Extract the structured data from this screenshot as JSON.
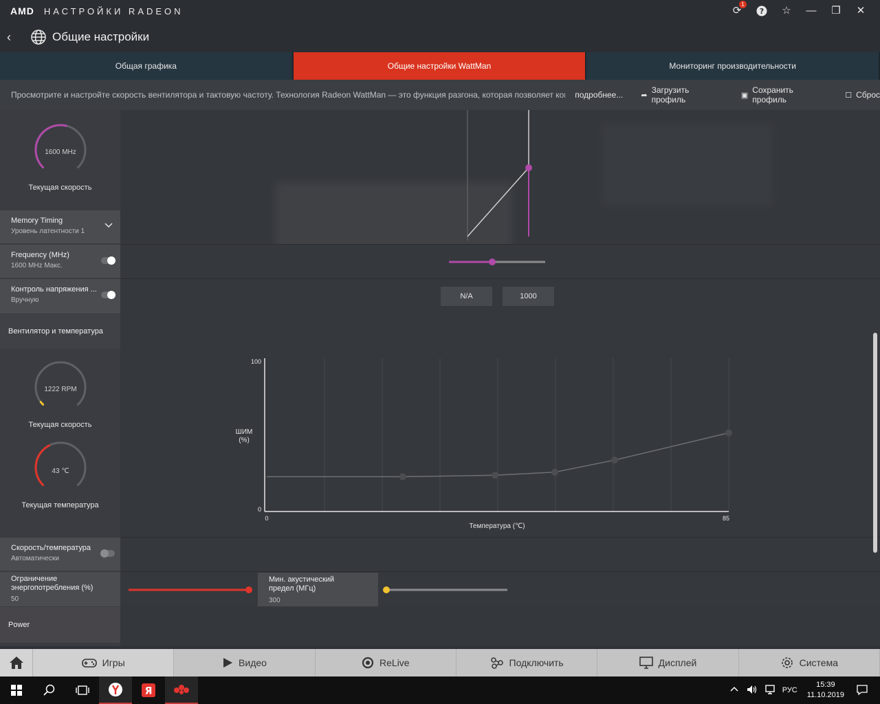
{
  "app": {
    "brand": "AMD",
    "title": "НАСТРОЙКИ RADEON",
    "notification_count": "1"
  },
  "header": {
    "page_title": "Общие настройки"
  },
  "tabs": [
    {
      "label": "Общая графика"
    },
    {
      "label": "Общие настройки WattMan"
    },
    {
      "label": "Мониторинг производительности"
    }
  ],
  "info": {
    "text": "Просмотрите и настройте скорость вентилятора и тактовую частоту. Технология Radeon WattMan — это функция разгона, которая позволяет контролироват...",
    "more": "подробнее...",
    "load_profile": "Загрузить профиль",
    "save_profile": "Сохранить профиль",
    "reset": "Сброс"
  },
  "memory": {
    "gauge_value": "1600 MHz",
    "gauge_fraction": 0.55,
    "gauge_label": "Текущая скорость",
    "timing_title": "Memory Timing",
    "timing_value": "Уровень латентности 1",
    "freq_title": "Frequency (MHz)",
    "freq_value": "1600 MHz Макс.",
    "voltage_title": "Контроль напряжения ...",
    "voltage_value": "Вручную",
    "voltage_na": "N/A",
    "voltage_input": "1000"
  },
  "fan": {
    "section_title": "Вентилятор и температура",
    "rpm_value": "1222 RPM",
    "rpm_fraction": 0.03,
    "rpm_label": "Текущая скорость",
    "temp_value": "43 ℃",
    "temp_fraction": 0.4,
    "temp_label": "Текущая температура",
    "speed_temp_title": "Скорость/температура",
    "speed_temp_value": "Автоматически",
    "power_limit_title": "Ограничение энергопотребления (%)",
    "power_limit_value": "50",
    "acoustic_title": "Мин. акустический предел (МГц)",
    "acoustic_value": "300"
  },
  "power": {
    "section_title": "Power"
  },
  "chart_data": {
    "type": "line",
    "x": [
      0,
      25,
      42,
      53,
      64,
      85
    ],
    "series": [
      {
        "values": [
          23,
          23,
          24,
          26,
          34,
          52
        ]
      }
    ],
    "xlabel": "Температура (℃)",
    "ylabel": "ШИМ (%)",
    "ylabel_line1": "ШИМ",
    "ylabel_line2": "(%)",
    "xlim": [
      0,
      85
    ],
    "ylim": [
      0,
      100
    ],
    "x_ticks": [
      "0",
      "85"
    ],
    "y_ticks": [
      "0",
      "100"
    ],
    "grid": true
  },
  "nav": {
    "games": "Игры",
    "video": "Видео",
    "relive": "ReLive",
    "connect": "Подключить",
    "display": "Дисплей",
    "system": "Система"
  },
  "taskbar": {
    "lang": "РУС",
    "time": "15:39",
    "date": "11.10.2019"
  },
  "colors": {
    "accent": "#d9341f",
    "magenta": "#b04aa8",
    "fan_yellow": "#f2c230",
    "power_red": "#e0352b"
  }
}
